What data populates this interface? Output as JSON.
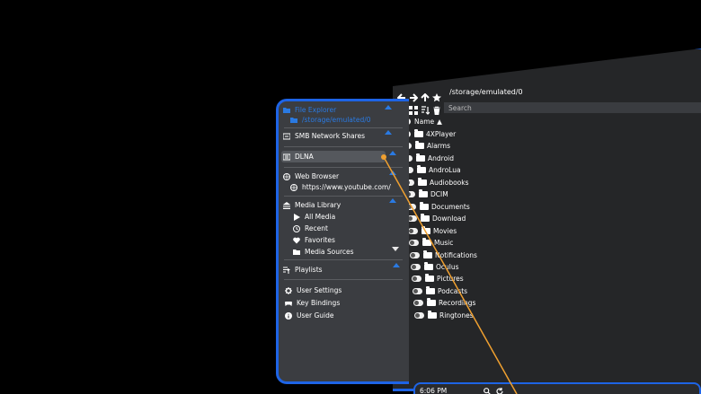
{
  "sidebar": {
    "file_explorer": {
      "label": "File Explorer",
      "path": "/storage/emulated/0"
    },
    "smb": {
      "label": "SMB Network Shares"
    },
    "dlna": {
      "label": "DLNA"
    },
    "web_browser": {
      "label": "Web Browser",
      "url": "https://www.youtube.com/"
    },
    "media_library": {
      "label": "Media Library",
      "items": [
        {
          "label": "All Media",
          "icon": "play-icon"
        },
        {
          "label": "Recent",
          "icon": "clock-icon"
        },
        {
          "label": "Favorites",
          "icon": "heart-icon"
        },
        {
          "label": "Media Sources",
          "icon": "folder-icon"
        }
      ]
    },
    "playlists": {
      "label": "Playlists"
    },
    "bottom_items": [
      {
        "label": "User Settings",
        "icon": "gear-icon"
      },
      {
        "label": "Key Bindings",
        "icon": "gamepad-icon"
      },
      {
        "label": "User Guide",
        "icon": "info-icon"
      }
    ]
  },
  "browser": {
    "path": "/storage/emulated/0",
    "search_placeholder": "Search",
    "column_header": "Name",
    "folders": [
      "4XPlayer",
      "Alarms",
      "Android",
      "AndroLua",
      "Audiobooks",
      "DCIM",
      "Documents",
      "Download",
      "Movies",
      "Music",
      "Notifications",
      "Oculus",
      "Pictures",
      "Podcasts",
      "Recordings",
      "Ringtones"
    ]
  },
  "status": {
    "time": "6:06 PM"
  },
  "colors": {
    "accent": "#1e64e6",
    "pointer": "#f0a030"
  }
}
